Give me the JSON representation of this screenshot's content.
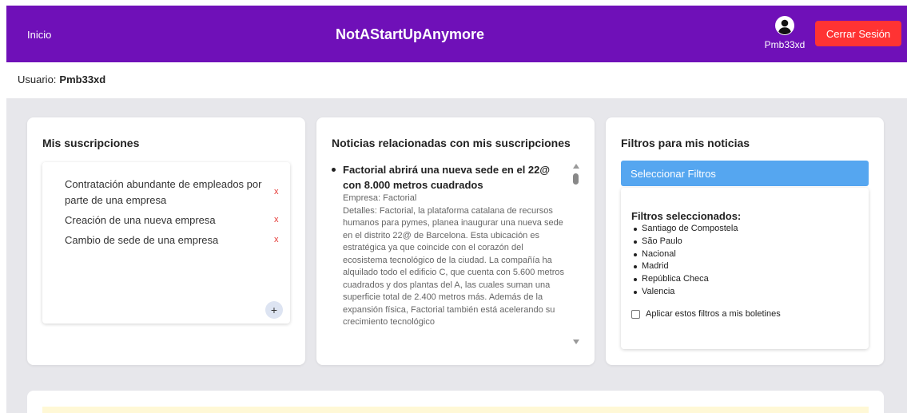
{
  "header": {
    "home_label": "Inicio",
    "brand": "NotAStartUpAnymore",
    "username": "Pmb33xd",
    "logout_label": "Cerrar Sesión"
  },
  "user_line": {
    "label": "Usuario:",
    "username": "Pmb33xd"
  },
  "subscriptions": {
    "title": "Mis suscripciones",
    "items": [
      {
        "label": "Contratación abundante de empleados por parte de una empresa",
        "remove": "x"
      },
      {
        "label": "Creación de una nueva empresa",
        "remove": "x"
      },
      {
        "label": "Cambio de sede de una empresa",
        "remove": "x"
      }
    ],
    "add_label": "+"
  },
  "news": {
    "title": "Noticias relacionadas con mis suscripciones",
    "items": [
      {
        "title": "Factorial abrirá una nueva sede en el 22@ con 8.000 metros cuadrados",
        "company": "Empresa: Factorial",
        "details": "Detalles: Factorial, la plataforma catalana de recursos humanos para pymes, planea inaugurar una nueva sede en el distrito 22@ de Barcelona. Esta ubicación es estratégica ya que coincide con el corazón del ecosistema tecnológico de la ciudad. La compañía ha alquilado todo el edificio C, que cuenta con 5.600 metros cuadrados y dos plantas del A, las cuales suman una superficie total de 2.400 metros más. Además de la expansión física, Factorial también está acelerando su crecimiento tecnológico"
      }
    ]
  },
  "filters": {
    "title": "Filtros para mis noticias",
    "select_label": "Seleccionar Filtros",
    "selected_title": "Filtros seleccionados:",
    "selected": [
      "Santiago de Compostela",
      "São Paulo",
      "Nacional",
      "Madrid",
      "República Checa",
      "Valencia"
    ],
    "apply_label": "Aplicar estos filtros a mis boletines",
    "apply_checked": false
  },
  "colors": {
    "header_bg": "#6f10b8",
    "logout_bg": "#ff3333",
    "filter_button_bg": "#55a6f0",
    "remove_x": "#e53935",
    "main_bg": "#e7e7eb"
  },
  "icons": {
    "user": "user-circle-icon",
    "remove": "remove-x-icon",
    "add": "plus-icon"
  }
}
